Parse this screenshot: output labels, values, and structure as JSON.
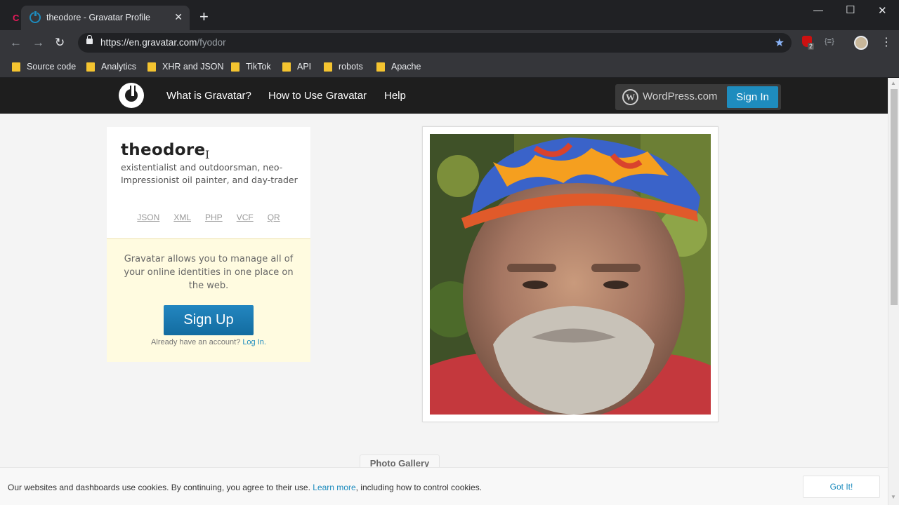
{
  "browser": {
    "tab_title": "theodore - Gravatar Profile",
    "tab_close": "✕",
    "new_tab": "+",
    "url_host": "https://en.gravatar.com",
    "url_path": "/fyodor",
    "bookmarks": [
      "Source code",
      "Analytics",
      "XHR and JSON",
      "TikTok",
      "API",
      "robots",
      "Apache"
    ],
    "extension_badge": "2"
  },
  "site": {
    "nav": [
      "What is Gravatar?",
      "How to Use Gravatar",
      "Help"
    ],
    "wordpress_label": "WordPress.com",
    "wordpress_glyph": "W",
    "signin_label": "Sign In"
  },
  "profile": {
    "name": "theodore",
    "bio": "existentialist and outdoorsman, neo-Impressionist oil painter, and day-trader",
    "formats": [
      "JSON",
      "XML",
      "PHP",
      "VCF",
      "QR"
    ]
  },
  "promo": {
    "text": "Gravatar allows you to manage all of your online identities in one place on the web.",
    "signup_label": "Sign Up",
    "account_prompt": "Already have an account?",
    "login_label": "Log In."
  },
  "gallery": {
    "label": "Photo Gallery"
  },
  "cookie": {
    "text_before": "Our websites and dashboards use cookies. By continuing, you agree to their use.",
    "learn_more": "Learn more",
    "text_after": ", including how to control cookies.",
    "button_label": "Got It!"
  },
  "colors": {
    "accent": "#1e8cbe",
    "header_bg": "#1e1e1e",
    "promo_bg": "#fffbe0"
  }
}
